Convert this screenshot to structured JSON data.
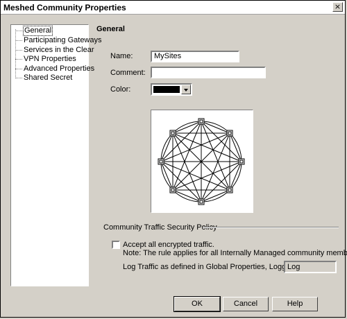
{
  "window": {
    "title": "Meshed Community Properties",
    "close_glyph": "×"
  },
  "tree": {
    "items": [
      {
        "label": "General",
        "selected": true
      },
      {
        "label": "Participating Gateways"
      },
      {
        "label": "Services in the Clear"
      },
      {
        "label": "VPN Properties"
      },
      {
        "label": "Advanced Properties"
      },
      {
        "label": "Shared Secret"
      }
    ]
  },
  "general": {
    "title": "General",
    "name_label": "Name:",
    "name_value": "MySites",
    "comment_label": "Comment:",
    "comment_value": "",
    "color_label": "Color:",
    "color_value": "#000000"
  },
  "policy": {
    "group_title": "Community Traffic Security Policy",
    "accept_label": "Accept all encrypted traffic.",
    "accept_checked": false,
    "note": "Note: The rule applies for all Internally Managed community members.",
    "log_label": "Log Traffic as defined in Global Properties, Logging Tab:",
    "log_value": "Log"
  },
  "buttons": {
    "ok": "OK",
    "cancel": "Cancel",
    "help": "Help"
  },
  "icons": {
    "close": "close-icon",
    "dropdown": "chevron-down-icon",
    "gateway": "gateway-icon",
    "mesh": "mesh-diagram-icon"
  }
}
